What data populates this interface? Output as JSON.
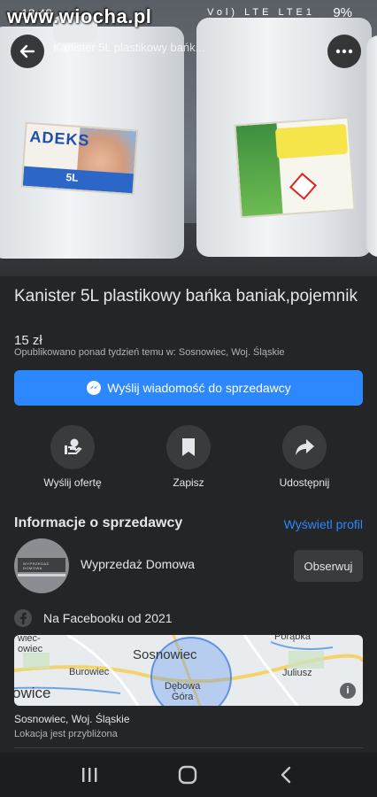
{
  "status_bar": {
    "time": "18:48",
    "battery": "9%",
    "network_icons": "Vol) LTE LTE1"
  },
  "watermark": "www.wiocha.pl",
  "header": {
    "title": "Kanister 5L plastikowy bańk..."
  },
  "photo": {
    "label_left": "ADEKS",
    "label_left_size": "5L"
  },
  "listing": {
    "title": "Kanister 5L plastikowy bańka baniak,pojemnik",
    "price": "15 zł",
    "posted": "Opublikowano ponad tydzień temu w: Sosnowiec, Woj. Śląskie"
  },
  "message_button": {
    "label": "Wyślij wiadomość do sprzedawcy"
  },
  "actions": [
    {
      "label": "Wyślij ofertę",
      "icon": "offer-hand-icon"
    },
    {
      "label": "Zapisz",
      "icon": "bookmark-icon"
    },
    {
      "label": "Udostępnij",
      "icon": "share-arrow-icon"
    }
  ],
  "seller": {
    "heading": "Informacje o sprzedawcy",
    "view_profile": "Wyświetl profil",
    "name": "Wyprzedaż Domowa",
    "avatar_text": "WYPRZEDAŻ DOMOWA",
    "follow": "Obserwuj",
    "since": "Na Facebooku od 2021"
  },
  "map": {
    "labels": {
      "top_left": "wiec-\nowiec",
      "porabka": "Porąbka",
      "sosnowiec": "Sosnowiec",
      "burowiec": "Burowiec",
      "juliusz": "Juliusz",
      "debowa_gora": "Dębowa\nGóra",
      "bottom_left": "owice"
    }
  },
  "location": {
    "name": "Sosnowiec, Woj. Śląskie",
    "note": "Lokacja jest przybliżona"
  },
  "colors": {
    "accent": "#2d88ff",
    "background": "#242526",
    "button": "#3a3b3c"
  }
}
